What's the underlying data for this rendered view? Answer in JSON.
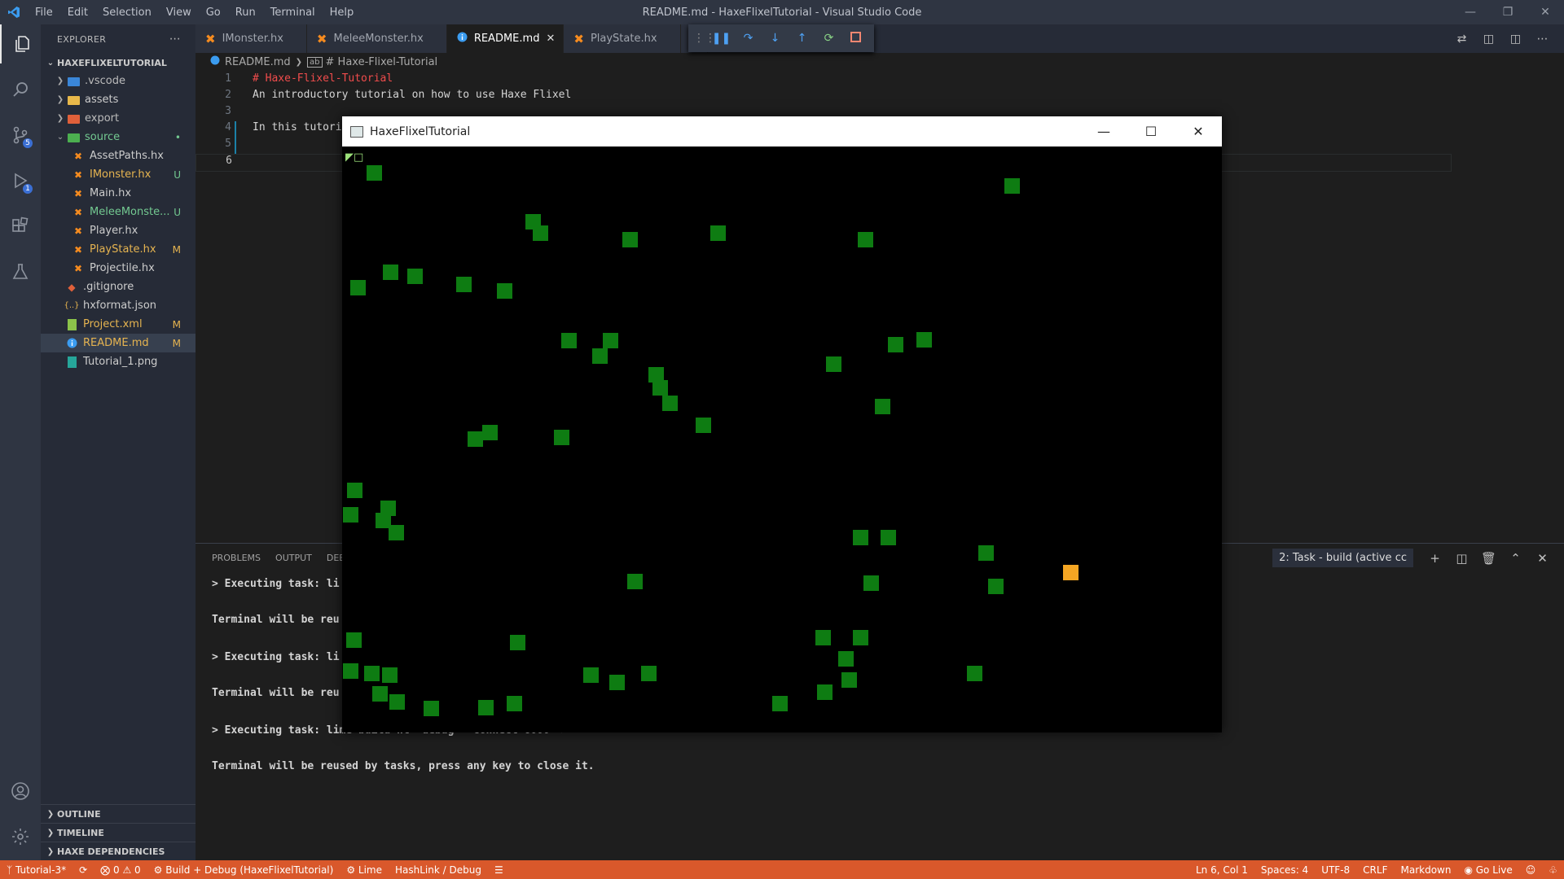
{
  "titlebar": {
    "menu": [
      "File",
      "Edit",
      "Selection",
      "View",
      "Go",
      "Run",
      "Terminal",
      "Help"
    ],
    "title": "README.md - HaxeFlixelTutorial - Visual Studio Code"
  },
  "activity": {
    "scm_badge": "5",
    "debug_badge": "1"
  },
  "sidebar": {
    "header": "EXPLORER",
    "project": "HAXEFLIXELTUTORIAL",
    "items": [
      {
        "label": ".vscode",
        "status": ""
      },
      {
        "label": "assets",
        "status": ""
      },
      {
        "label": "export",
        "status": ""
      },
      {
        "label": "source",
        "status": "•"
      },
      {
        "label": "AssetPaths.hx",
        "status": ""
      },
      {
        "label": "IMonster.hx",
        "status": "U"
      },
      {
        "label": "Main.hx",
        "status": ""
      },
      {
        "label": "MeleeMonste...",
        "status": "U"
      },
      {
        "label": "Player.hx",
        "status": ""
      },
      {
        "label": "PlayState.hx",
        "status": "M"
      },
      {
        "label": "Projectile.hx",
        "status": ""
      },
      {
        "label": ".gitignore",
        "status": ""
      },
      {
        "label": "hxformat.json",
        "status": ""
      },
      {
        "label": "Project.xml",
        "status": "M"
      },
      {
        "label": "README.md",
        "status": "M"
      },
      {
        "label": "Tutorial_1.png",
        "status": ""
      }
    ],
    "sections": [
      "OUTLINE",
      "TIMELINE",
      "HAXE DEPENDENCIES"
    ]
  },
  "tabs": [
    {
      "label": "IMonster.hx"
    },
    {
      "label": "MeleeMonster.hx"
    },
    {
      "label": "README.md"
    },
    {
      "label": "PlayState.hx"
    }
  ],
  "breadcrumb": {
    "file": "README.md",
    "symbol": "# Haxe-Flixel-Tutorial"
  },
  "code": {
    "lines": [
      {
        "n": "1",
        "text": "# Haxe-Flixel-Tutorial"
      },
      {
        "n": "2",
        "text": "An introductory tutorial on how to use Haxe Flixel"
      },
      {
        "n": "3",
        "text": ""
      },
      {
        "n": "4",
        "text": "In this tutori"
      },
      {
        "n": "5",
        "text": ""
      },
      {
        "n": "6",
        "text": ""
      }
    ]
  },
  "panel": {
    "tabs": [
      "PROBLEMS",
      "OUTPUT",
      "DEE"
    ],
    "terminal_select": "2: Task - build (active cc",
    "terminal_lines": [
      "> Executing task: li",
      "Terminal will be reu",
      "> Executing task: li",
      "Terminal will be reu",
      "> Executing task: lime build hl -debug --connect 6000 <",
      "Terminal will be reused by tasks, press any key to close it."
    ]
  },
  "game_window": {
    "title": "HaxeFlixelTutorial",
    "colors": {
      "monster": "#0e7c12",
      "player": "#f5a623"
    }
  },
  "statusbar": {
    "branch": "Tutorial-3*",
    "errors": "0",
    "warnings": "0",
    "launch": "Build + Debug (HaxeFlixelTutorial)",
    "lime": "Lime",
    "target": "HashLink / Debug",
    "position": "Ln 6, Col 1",
    "spaces": "Spaces: 4",
    "encoding": "UTF-8",
    "eol": "CRLF",
    "language": "Markdown",
    "golive": "Go Live"
  }
}
